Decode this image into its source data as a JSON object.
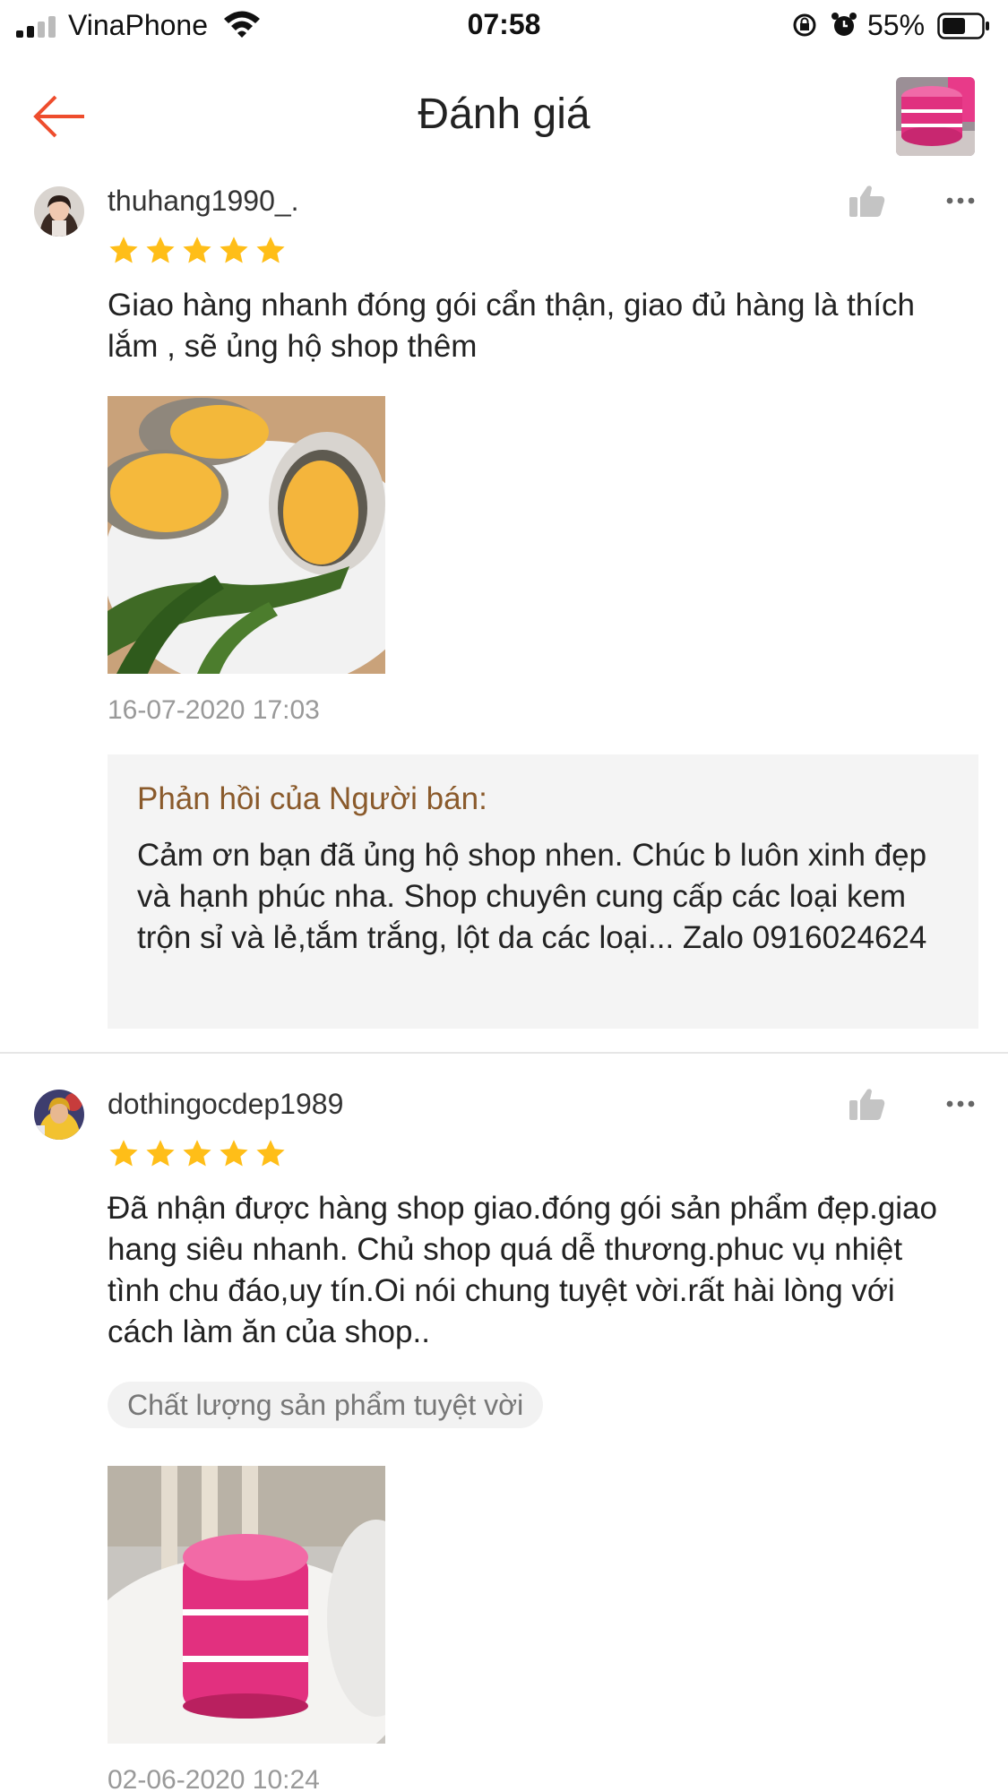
{
  "status_bar": {
    "carrier": "VinaPhone",
    "time": "07:58",
    "battery": "55%"
  },
  "header": {
    "title": "Đánh giá"
  },
  "reviews": [
    {
      "username": "thuhang1990_.",
      "rating": 5,
      "text": "Giao hàng nhanh đóng gói cẩn thận, giao đủ hàng là thích lắm , sẽ ủng hộ shop thêm",
      "date": "16-07-2020 17:03",
      "seller_reply_label": "Phản hồi của Người bán:",
      "seller_reply": "Cảm ơn bạn đã ủng hộ shop nhen. Chúc b luôn xinh đẹp và hạnh phúc nha. Shop chuyên cung cấp các loại kem trộn sỉ và lẻ,tắm trắng, lột da các loại... Zalo 0916024624"
    },
    {
      "username": "dothingocdep1989",
      "rating": 5,
      "text": "Đã nhận được hàng shop giao.đóng gói sản phẩm đẹp.giao hang siêu nhanh. Chủ shop quá dễ thương.phuc vụ nhiệt tình chu đáo,uy tín.Oi nói chung tuyệt vời.rất hài lòng với cách làm ăn của shop..",
      "tag": "Chất lượng sản phẩm tuyệt vời",
      "date": "02-06-2020 10:24"
    }
  ],
  "colors": {
    "accent": "#ee4d2d",
    "star": "#ffbe18",
    "seller_label": "#8a5a2b",
    "muted": "#999999"
  },
  "icons": [
    "back-arrow-icon",
    "thumbs-up-icon",
    "more-icon",
    "star-icon",
    "wifi-icon",
    "alarm-icon",
    "battery-icon"
  ]
}
